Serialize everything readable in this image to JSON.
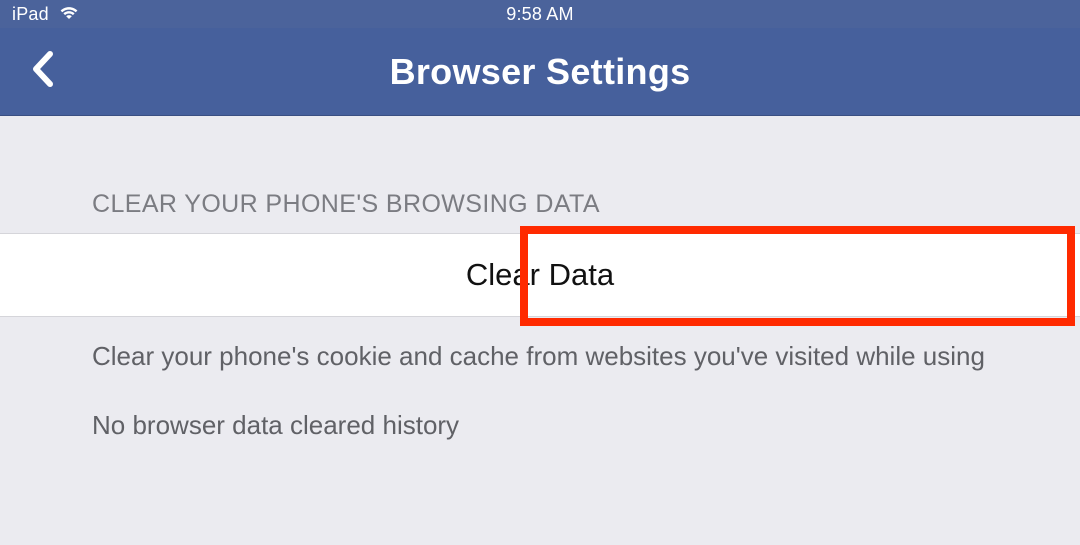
{
  "statusbar": {
    "device": "iPad",
    "time": "9:58 AM"
  },
  "navbar": {
    "title": "Browser Settings"
  },
  "section": {
    "header": "CLEAR YOUR PHONE'S BROWSING DATA",
    "button_label": "Clear Data",
    "description": "Clear your phone's cookie and cache from websites you've visited while using the",
    "history_note": "No browser data cleared history"
  },
  "colors": {
    "navbar_bg": "#46609c",
    "highlight": "#ff2a00"
  }
}
